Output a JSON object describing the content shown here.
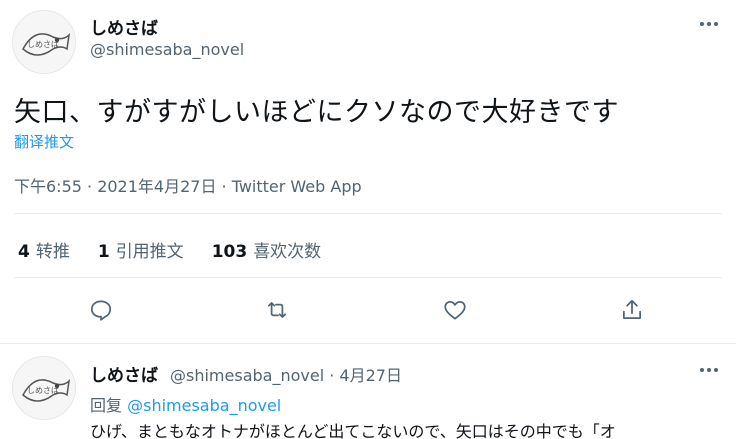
{
  "main_tweet": {
    "author_name": "しめさば",
    "author_handle": "@shimesaba_novel",
    "text": "矢口、すがすがしいほどにクソなので大好きです",
    "translate_label": "翻译推文",
    "timestamp": "下午6:55 · 2021年4月27日 · Twitter Web App",
    "stats": {
      "retweets_count": "4",
      "retweets_label": "转推",
      "quotes_count": "1",
      "quotes_label": "引用推文",
      "likes_count": "103",
      "likes_label": "喜欢次数"
    },
    "actions": [
      "reply-icon",
      "retweet-icon",
      "like-icon",
      "share-icon"
    ],
    "more_icon": "more-icon"
  },
  "reply_tweet": {
    "author_name": "しめさば",
    "author_handle": "@shimesaba_novel",
    "date": "· 4月27日",
    "reply_prefix": "回复",
    "reply_to": "@shimesaba_novel",
    "text": "ひげ、まともなオトナがほとんど出てこないので、矢口はその中でも「オ"
  },
  "colors": {
    "text": "#0f1419",
    "secondary": "#536471",
    "link": "#1d9bf0",
    "divider": "#e6ecf0"
  }
}
